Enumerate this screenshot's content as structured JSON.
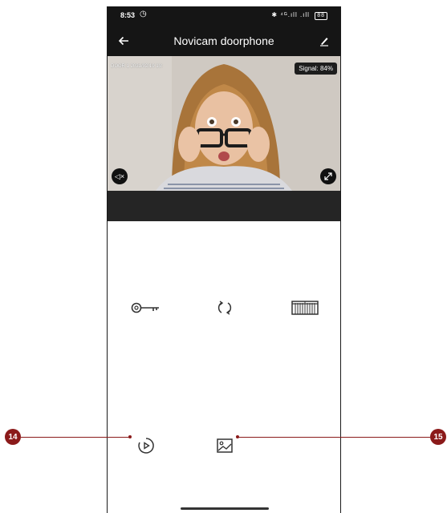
{
  "status_bar": {
    "time": "8:53",
    "alarm_glyph": "◷",
    "right_indicators": "✱ ⁴ᴳ.ıll .ıll",
    "battery": "88"
  },
  "app_bar": {
    "title": "Novicam doorphone",
    "back_icon": "arrow-left",
    "edit_icon": "pencil"
  },
  "video": {
    "overlay_text": "DOOR 1 2021/02/19 19:",
    "signal_label": "Signal: 84%",
    "mute_glyph": "◁×"
  },
  "controls": [
    {
      "name": "unlock-door",
      "icon": "key-icon"
    },
    {
      "name": "switch-camera",
      "icon": "refresh-icon"
    },
    {
      "name": "open-gate",
      "icon": "gate-icon"
    },
    {
      "name": "playback",
      "icon": "playback-icon"
    },
    {
      "name": "gallery",
      "icon": "image-icon"
    }
  ],
  "callouts": {
    "left_number": "14",
    "right_number": "15",
    "color": "#8b1a1a"
  }
}
